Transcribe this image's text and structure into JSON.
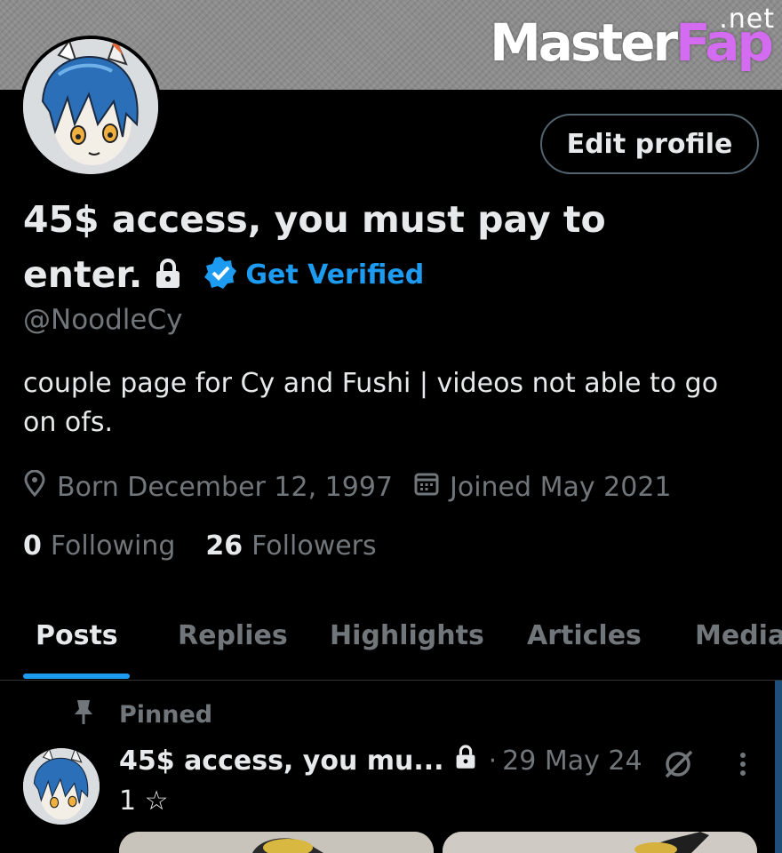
{
  "watermark": {
    "main": "Master",
    "accent": "Fap",
    "suffix": ".net"
  },
  "profile": {
    "edit_button": "Edit profile",
    "name_line1": "45$ access, you must pay to",
    "name_line2": "enter.",
    "get_verified": "Get Verified",
    "handle": "@NoodleCy",
    "bio_line1": "couple page for Cy and Fushi | videos not able to go",
    "bio_line2": "on ofs.",
    "born": "Born December 12, 1997",
    "joined": "Joined May 2021",
    "following_count": "0",
    "following_label": "Following",
    "followers_count": "26",
    "followers_label": "Followers"
  },
  "tabs": [
    {
      "label": "Posts",
      "active": true
    },
    {
      "label": "Replies",
      "active": false
    },
    {
      "label": "Highlights",
      "active": false
    },
    {
      "label": "Articles",
      "active": false
    },
    {
      "label": "Media",
      "active": false
    }
  ],
  "pinned_post": {
    "pinned_label": "Pinned",
    "name": "45$ access, you mu...",
    "dot": "·",
    "date": "29 May 24",
    "text": "1 ☆"
  },
  "colors": {
    "accent": "#1d9bf0",
    "muted": "#71767b",
    "text": "#e7e9ea",
    "background": "#000000"
  },
  "icons": [
    "lock-icon",
    "verified-badge-icon",
    "location-icon",
    "calendar-icon",
    "pin-icon",
    "grok-icon",
    "more-icon"
  ]
}
